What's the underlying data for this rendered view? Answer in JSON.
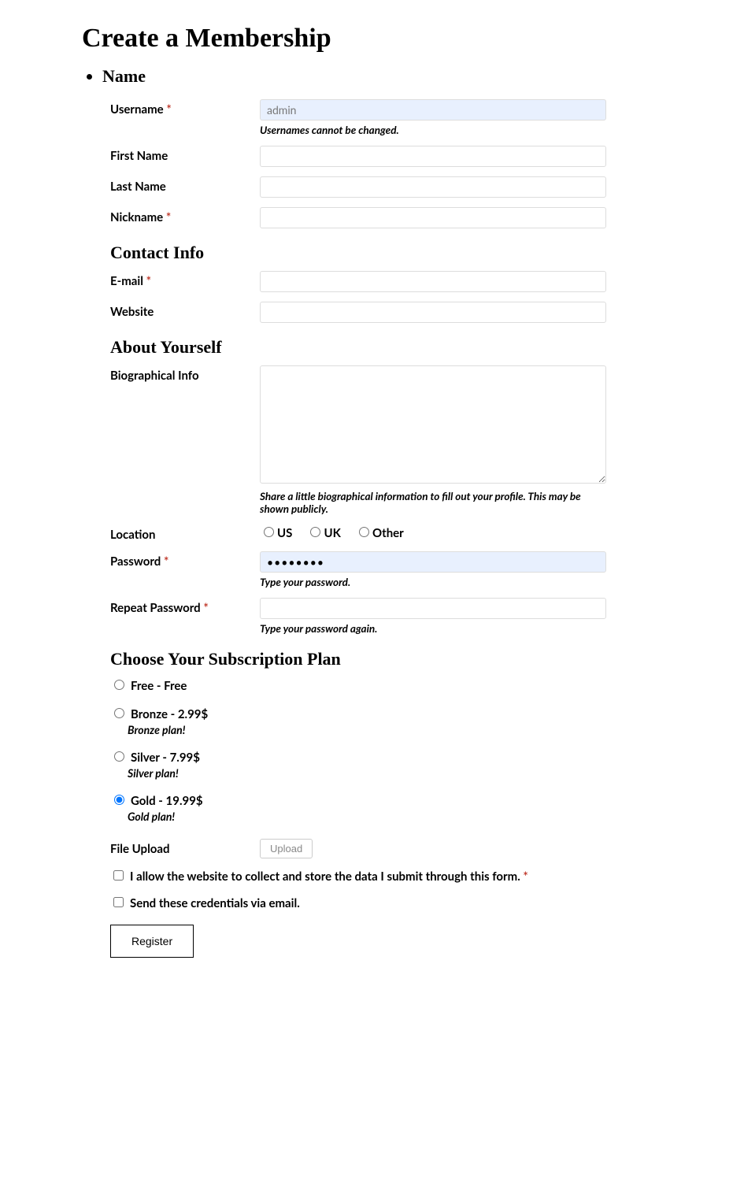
{
  "title": "Create a Membership",
  "section_name": "Name",
  "required_marker": "*",
  "fields": {
    "username": {
      "label": "Username",
      "value": "admin",
      "desc": "Usernames cannot be changed."
    },
    "first_name": {
      "label": "First Name"
    },
    "last_name": {
      "label": "Last Name"
    },
    "nickname": {
      "label": "Nickname"
    }
  },
  "contact_heading": "Contact Info",
  "contact": {
    "email": {
      "label": "E-mail"
    },
    "website": {
      "label": "Website"
    }
  },
  "about_heading": "About Yourself",
  "about": {
    "bio": {
      "label": "Biographical Info",
      "desc": "Share a little biographical information to fill out your profile. This may be shown publicly."
    },
    "location": {
      "label": "Location",
      "options": [
        "US",
        "UK",
        "Other"
      ]
    },
    "password": {
      "label": "Password",
      "value": "••••••••",
      "desc": "Type your password."
    },
    "repeat_password": {
      "label": "Repeat Password",
      "desc": "Type your password again."
    }
  },
  "subscription_heading": "Choose Your Subscription Plan",
  "plans": [
    {
      "label": "Free - Free",
      "desc": ""
    },
    {
      "label": "Bronze - 2.99$",
      "desc": "Bronze plan!"
    },
    {
      "label": "Silver - 7.99$",
      "desc": "Silver plan!"
    },
    {
      "label": "Gold - 19.99$",
      "desc": "Gold plan!",
      "selected": true
    }
  ],
  "file_upload": {
    "label": "File Upload",
    "button": "Upload"
  },
  "consent": {
    "label": "I allow the website to collect and store the data I submit through this form."
  },
  "send_email": {
    "label": "Send these credentials via email."
  },
  "submit_label": "Register"
}
